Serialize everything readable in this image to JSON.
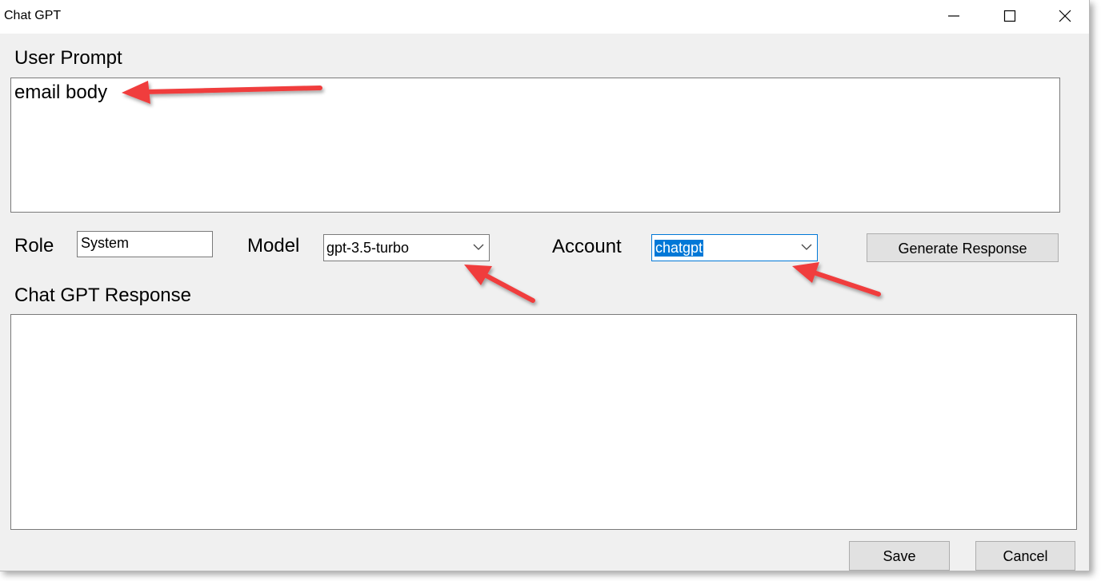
{
  "window": {
    "title": "Chat GPT"
  },
  "prompt": {
    "label": "User Prompt",
    "value": "email body"
  },
  "role": {
    "label": "Role",
    "value": "System"
  },
  "model": {
    "label": "Model",
    "selected": "gpt-3.5-turbo"
  },
  "account": {
    "label": "Account",
    "selected": "chatgpt"
  },
  "generate": {
    "label": "Generate Response"
  },
  "response": {
    "label": "Chat GPT Response",
    "value": ""
  },
  "footer": {
    "save_label": "Save",
    "cancel_label": "Cancel"
  },
  "icons": {
    "minimize": "minimize-icon",
    "maximize": "maximize-icon",
    "close": "close-icon",
    "dropdown": "chevron-down-icon",
    "annotation": "red-arrow-annotation"
  },
  "colors": {
    "window_bg": "#f0f0f0",
    "accent": "#0078d7",
    "annotation": "#f03c3c"
  }
}
